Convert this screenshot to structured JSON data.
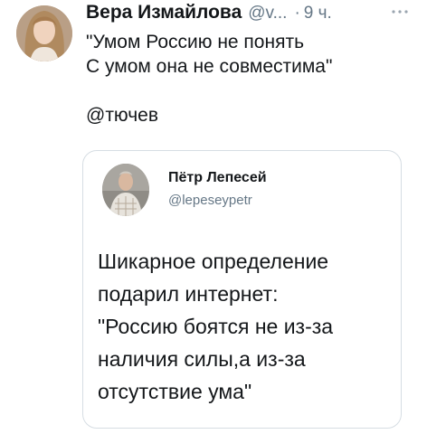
{
  "tweet": {
    "display_name": "Вера Измайлова",
    "handle": "@v...",
    "separator": "·",
    "time": "9 ч.",
    "lines": [
      "\"Умом Россию не понять",
      "С умом она не совместима\"",
      "",
      "@тючев"
    ],
    "more_icon": "more-dots-icon"
  },
  "quote": {
    "display_name": "Пётр Лепесей",
    "handle": "@lepeseypetr",
    "lines": [
      "Шикарное определение",
      "подарил интернет:",
      "\"Россию боятся не из-за",
      "наличия силы,а из-за",
      "отсутствие ума\""
    ]
  }
}
